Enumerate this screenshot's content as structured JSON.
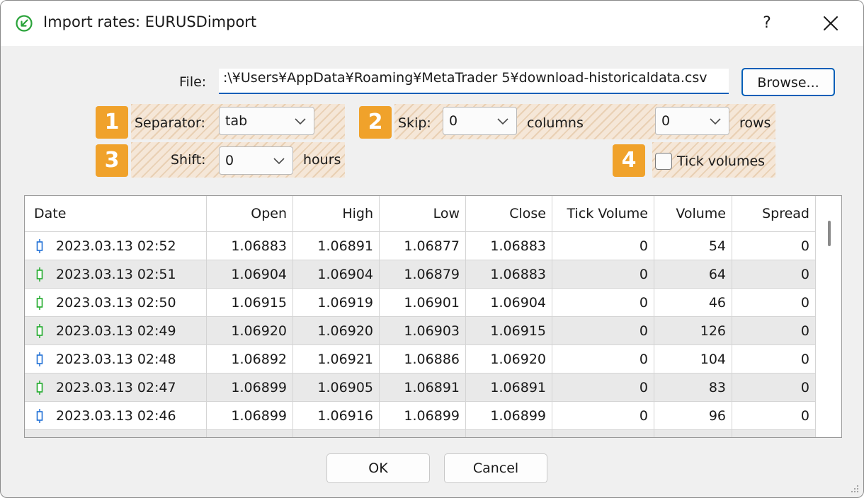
{
  "window": {
    "title": "Import rates: EURUSDimport",
    "help_label": "?"
  },
  "file": {
    "label": "File:",
    "value": ":\\¥Users¥AppData¥Roaming¥MetaTrader 5¥download-historicaldata.csv",
    "browse_label": "Browse..."
  },
  "options": {
    "separator": {
      "badge": "1",
      "label": "Separator:",
      "value": "tab"
    },
    "skip": {
      "badge": "2",
      "label": "Skip:",
      "columns_value": "0",
      "columns_label": "columns",
      "rows_value": "0",
      "rows_label": "rows"
    },
    "shift": {
      "badge": "3",
      "label": "Shift:",
      "value": "0",
      "unit": "hours"
    },
    "tick_volumes": {
      "badge": "4",
      "label": "Tick volumes",
      "checked": false
    }
  },
  "table": {
    "columns": [
      "Date",
      "Open",
      "High",
      "Low",
      "Close",
      "Tick Volume",
      "Volume",
      "Spread"
    ],
    "rows": [
      {
        "candle": "blue",
        "cells": [
          "2023.03.13 02:52",
          "1.06883",
          "1.06891",
          "1.06877",
          "1.06883",
          "0",
          "54",
          "0"
        ]
      },
      {
        "candle": "green",
        "cells": [
          "2023.03.13 02:51",
          "1.06904",
          "1.06904",
          "1.06879",
          "1.06883",
          "0",
          "64",
          "0"
        ]
      },
      {
        "candle": "green",
        "cells": [
          "2023.03.13 02:50",
          "1.06915",
          "1.06919",
          "1.06901",
          "1.06904",
          "0",
          "46",
          "0"
        ]
      },
      {
        "candle": "green",
        "cells": [
          "2023.03.13 02:49",
          "1.06920",
          "1.06920",
          "1.06903",
          "1.06915",
          "0",
          "126",
          "0"
        ]
      },
      {
        "candle": "blue",
        "cells": [
          "2023.03.13 02:48",
          "1.06892",
          "1.06921",
          "1.06886",
          "1.06920",
          "0",
          "104",
          "0"
        ]
      },
      {
        "candle": "green",
        "cells": [
          "2023.03.13 02:47",
          "1.06899",
          "1.06905",
          "1.06891",
          "1.06891",
          "0",
          "83",
          "0"
        ]
      },
      {
        "candle": "blue",
        "cells": [
          "2023.03.13 02:46",
          "1.06899",
          "1.06916",
          "1.06899",
          "1.06899",
          "0",
          "96",
          "0"
        ]
      }
    ]
  },
  "buttons": {
    "ok": "OK",
    "cancel": "Cancel"
  },
  "colors": {
    "accent": "#005fb8",
    "badge": "#f0a22b",
    "candle_blue": "#1f6fd6",
    "candle_green": "#1faa2a"
  }
}
